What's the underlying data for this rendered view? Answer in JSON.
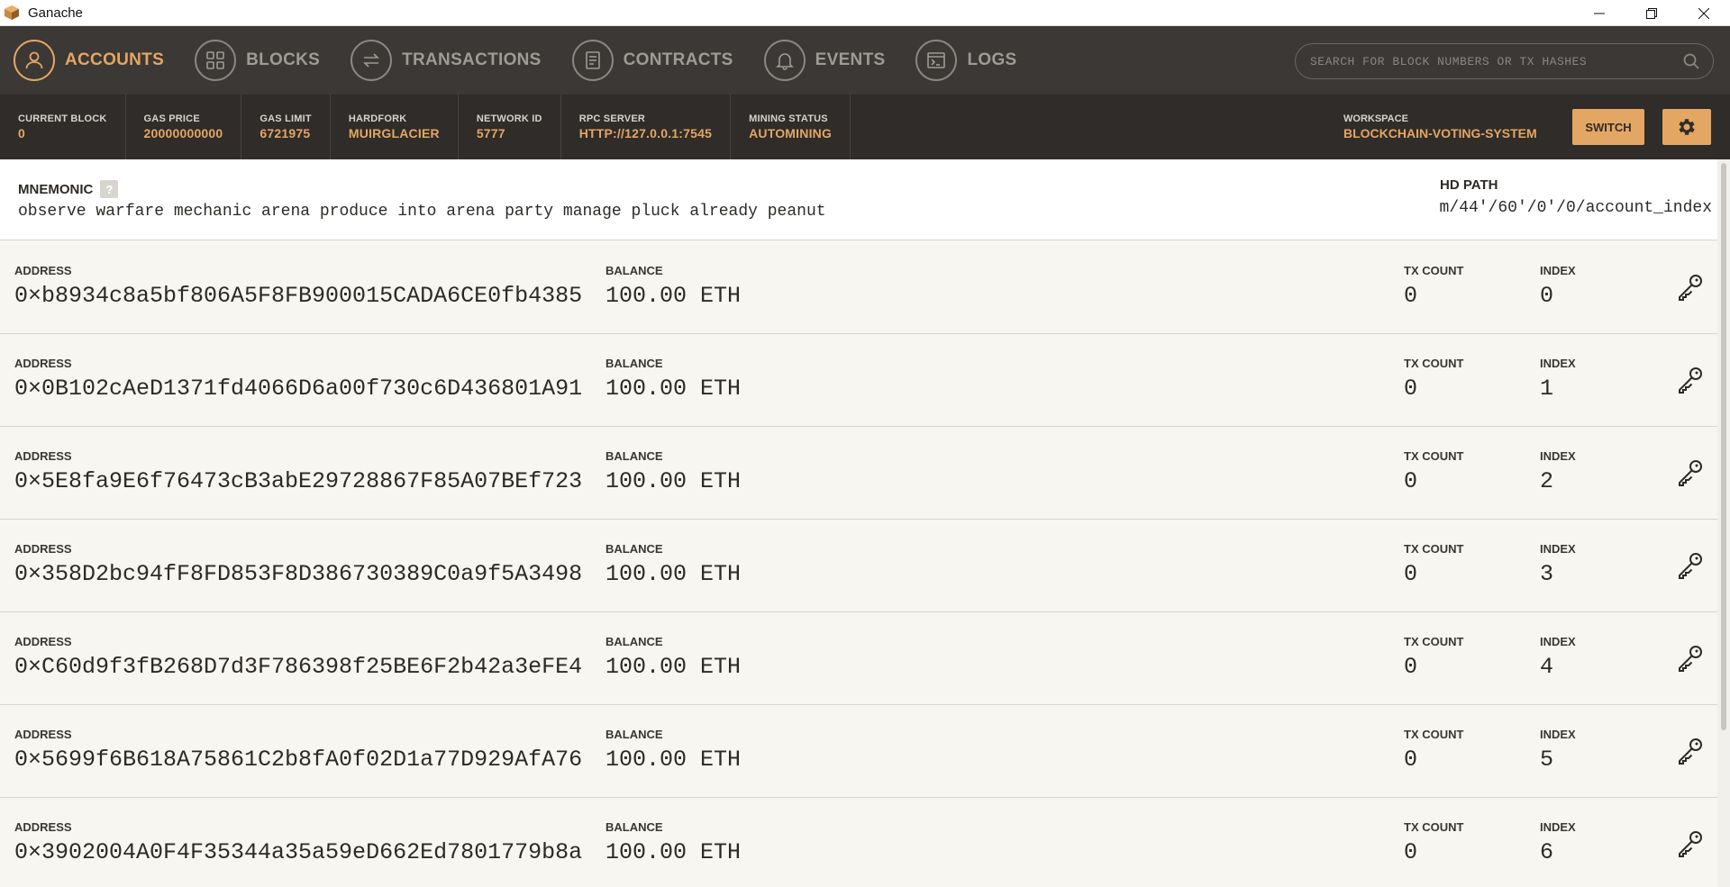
{
  "window": {
    "title": "Ganache"
  },
  "nav": {
    "items": [
      {
        "label": "ACCOUNTS",
        "icon": "user-icon",
        "active": true
      },
      {
        "label": "BLOCKS",
        "icon": "grid-icon",
        "active": false
      },
      {
        "label": "TRANSACTIONS",
        "icon": "arrows-icon",
        "active": false
      },
      {
        "label": "CONTRACTS",
        "icon": "document-icon",
        "active": false
      },
      {
        "label": "EVENTS",
        "icon": "bell-icon",
        "active": false
      },
      {
        "label": "LOGS",
        "icon": "terminal-icon",
        "active": false
      }
    ],
    "search_placeholder": "SEARCH FOR BLOCK NUMBERS OR TX HASHES"
  },
  "status": {
    "current_block_label": "CURRENT BLOCK",
    "current_block": "0",
    "gas_price_label": "GAS PRICE",
    "gas_price": "20000000000",
    "gas_limit_label": "GAS LIMIT",
    "gas_limit": "6721975",
    "hardfork_label": "HARDFORK",
    "hardfork": "MUIRGLACIER",
    "network_id_label": "NETWORK ID",
    "network_id": "5777",
    "rpc_server_label": "RPC SERVER",
    "rpc_server": "HTTP://127.0.0.1:7545",
    "mining_status_label": "MINING STATUS",
    "mining_status": "AUTOMINING",
    "workspace_label": "WORKSPACE",
    "workspace": "BLOCKCHAIN-VOTING-SYSTEM",
    "switch_label": "SWITCH"
  },
  "mnemonic": {
    "label": "MNEMONIC",
    "help": "?",
    "words": "observe warfare mechanic arena produce into arena party manage pluck already peanut",
    "hd_path_label": "HD PATH",
    "hd_path": "m/44'/60'/0'/0/account_index"
  },
  "labels": {
    "address": "ADDRESS",
    "balance": "BALANCE",
    "tx_count": "TX COUNT",
    "index": "INDEX"
  },
  "accounts": [
    {
      "address": "0×b8934c8a5bf806A5F8FB900015CADA6CE0fb4385",
      "balance": "100.00 ETH",
      "tx_count": "0",
      "index": "0"
    },
    {
      "address": "0×0B102cAeD1371fd4066D6a00f730c6D436801A91",
      "balance": "100.00 ETH",
      "tx_count": "0",
      "index": "1"
    },
    {
      "address": "0×5E8fa9E6f76473cB3abE29728867F85A07BEf723",
      "balance": "100.00 ETH",
      "tx_count": "0",
      "index": "2"
    },
    {
      "address": "0×358D2bc94fF8FD853F8D386730389C0a9f5A3498",
      "balance": "100.00 ETH",
      "tx_count": "0",
      "index": "3"
    },
    {
      "address": "0×C60d9f3fB268D7d3F786398f25BE6F2b42a3eFE4",
      "balance": "100.00 ETH",
      "tx_count": "0",
      "index": "4"
    },
    {
      "address": "0×5699f6B618A75861C2b8fA0f02D1a77D929AfA76",
      "balance": "100.00 ETH",
      "tx_count": "0",
      "index": "5"
    },
    {
      "address": "0×3902004A0F4F35344a35a59eD662Ed7801779b8a",
      "balance": "100.00 ETH",
      "tx_count": "0",
      "index": "6"
    }
  ],
  "colors": {
    "accent": "#e4a663",
    "nav_bg": "#3b3835",
    "status_bg": "#2f2c29",
    "content_bg": "#f7f6f1"
  }
}
